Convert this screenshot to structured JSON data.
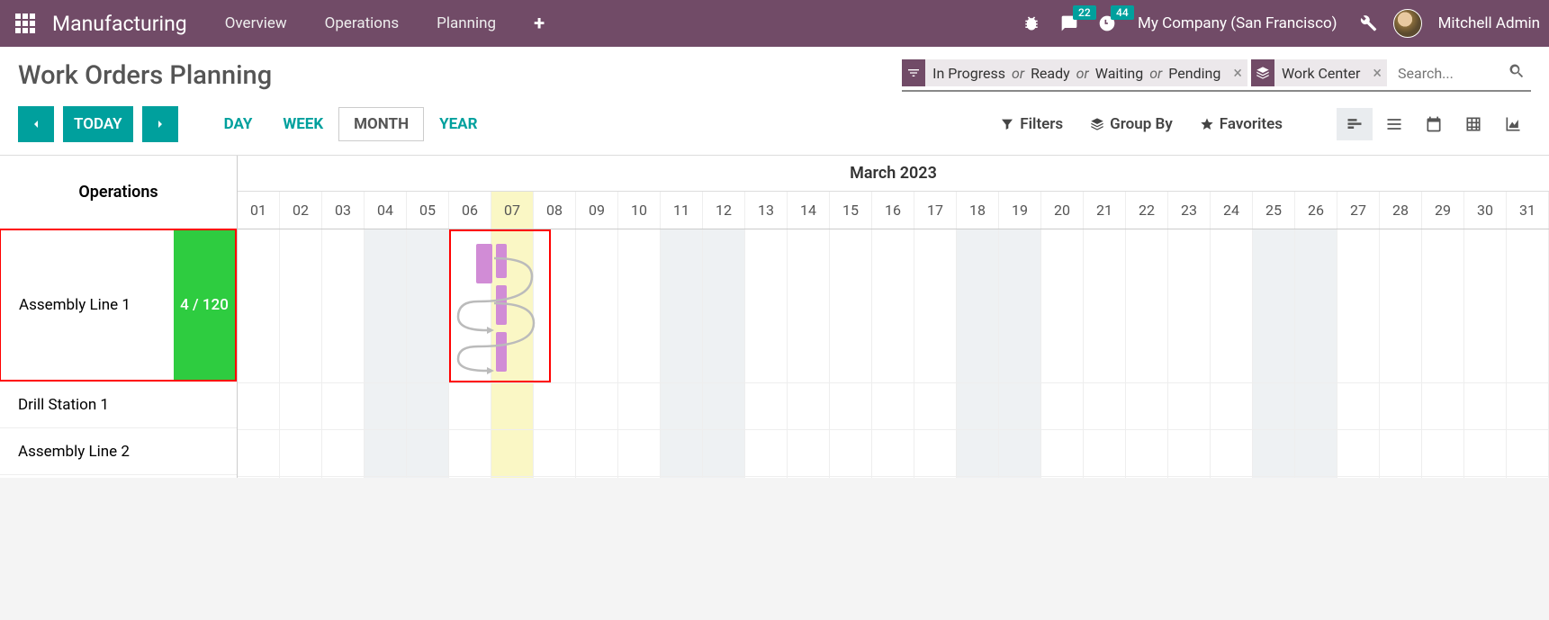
{
  "navbar": {
    "brand": "Manufacturing",
    "items": [
      "Overview",
      "Operations",
      "Planning"
    ],
    "messages_badge": "22",
    "activities_badge": "44",
    "company": "My Company (San Francisco)",
    "username": "Mitchell Admin"
  },
  "page": {
    "title": "Work Orders Planning"
  },
  "search": {
    "placeholder": "Search...",
    "facet_filter": {
      "parts": [
        "In Progress",
        "Ready",
        "Waiting",
        "Pending"
      ],
      "sep": "or"
    },
    "facet_group": "Work Center"
  },
  "controls": {
    "today": "TODAY",
    "scales": {
      "day": "DAY",
      "week": "WEEK",
      "month": "MONTH",
      "year": "YEAR"
    },
    "filters": "Filters",
    "groupby": "Group By",
    "favorites": "Favorites"
  },
  "gantt": {
    "side_header": "Operations",
    "month": "March 2023",
    "days": [
      "01",
      "02",
      "03",
      "04",
      "05",
      "06",
      "07",
      "08",
      "09",
      "10",
      "11",
      "12",
      "13",
      "14",
      "15",
      "16",
      "17",
      "18",
      "19",
      "20",
      "21",
      "22",
      "23",
      "24",
      "25",
      "26",
      "27",
      "28",
      "29",
      "30",
      "31"
    ],
    "today_index": 6,
    "weekend_indices": [
      3,
      4,
      10,
      11,
      17,
      18,
      24,
      25
    ],
    "rows": [
      {
        "name": "Assembly Line 1",
        "capacity": "4 / 120",
        "highlighted": true
      },
      {
        "name": "Drill Station 1"
      },
      {
        "name": "Assembly Line 2"
      }
    ]
  }
}
